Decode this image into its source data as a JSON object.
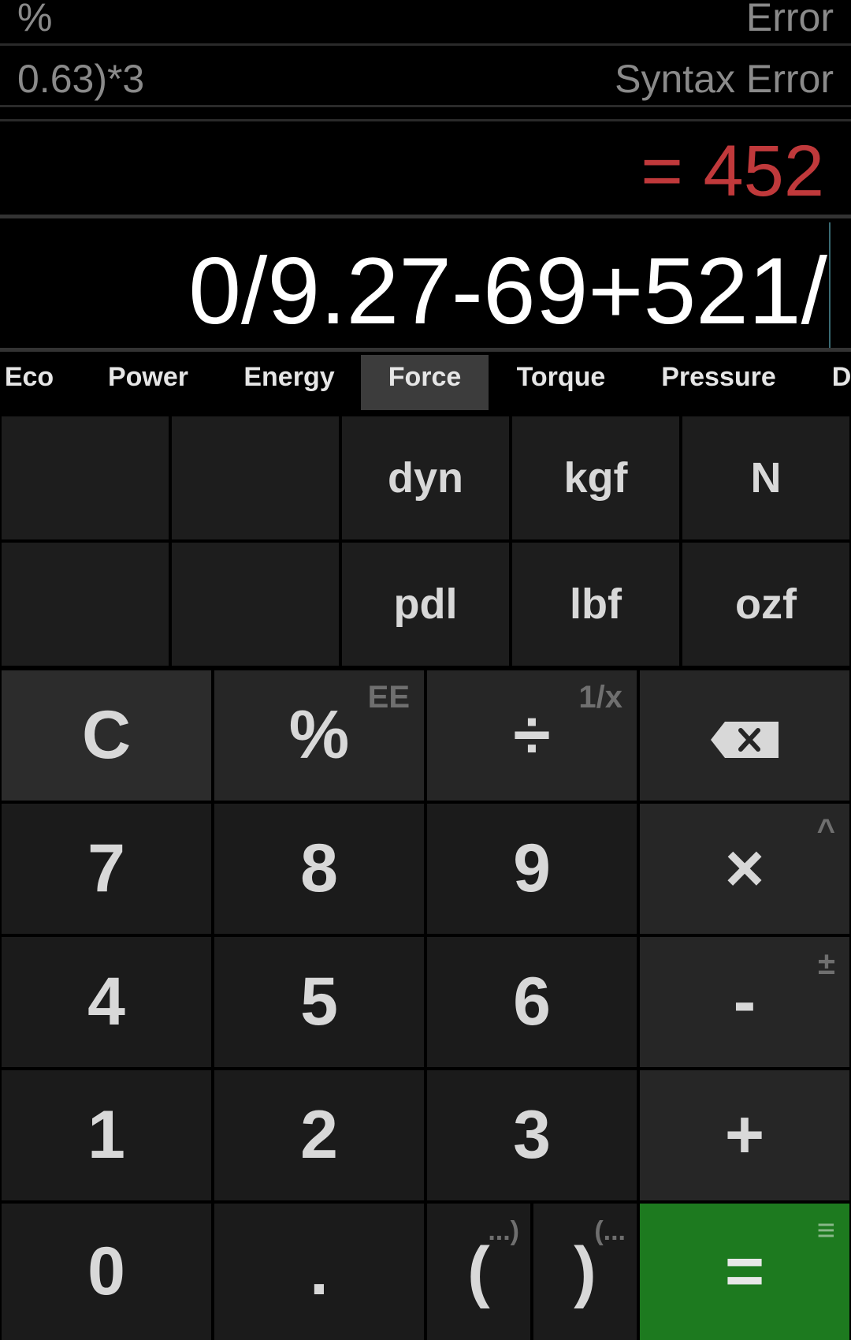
{
  "history": [
    {
      "expression": "%",
      "result": "Error"
    },
    {
      "expression": "0.63)*3",
      "result": "Syntax Error"
    }
  ],
  "result": "= 452",
  "expression": "0/9.27-69+521/",
  "categories": [
    "Eco",
    "Power",
    "Energy",
    "Force",
    "Torque",
    "Pressure",
    "D"
  ],
  "active_category": "Force",
  "units": {
    "row1": [
      "",
      "",
      "dyn",
      "kgf",
      "N"
    ],
    "row2": [
      "",
      "",
      "pdl",
      "lbf",
      "ozf"
    ]
  },
  "keys": {
    "clear": "C",
    "percent": "%",
    "percent_alt": "EE",
    "divide": "÷",
    "divide_alt": "1/x",
    "backspace_icon": "backspace-icon",
    "seven": "7",
    "eight": "8",
    "nine": "9",
    "multiply": "×",
    "multiply_alt": "^",
    "four": "4",
    "five": "5",
    "six": "6",
    "minus": "-",
    "minus_alt": "±",
    "one": "1",
    "two": "2",
    "three": "3",
    "plus": "+",
    "zero": "0",
    "dot": ".",
    "paren_open": "(",
    "paren_open_alt": "...)",
    "paren_close": ")",
    "paren_close_alt": "(...",
    "equals": "=",
    "equals_alt": "≡"
  },
  "colors": {
    "result": "#c0393b",
    "equals_key": "#1d7a1f",
    "active_tab": "#3c3c3c"
  }
}
